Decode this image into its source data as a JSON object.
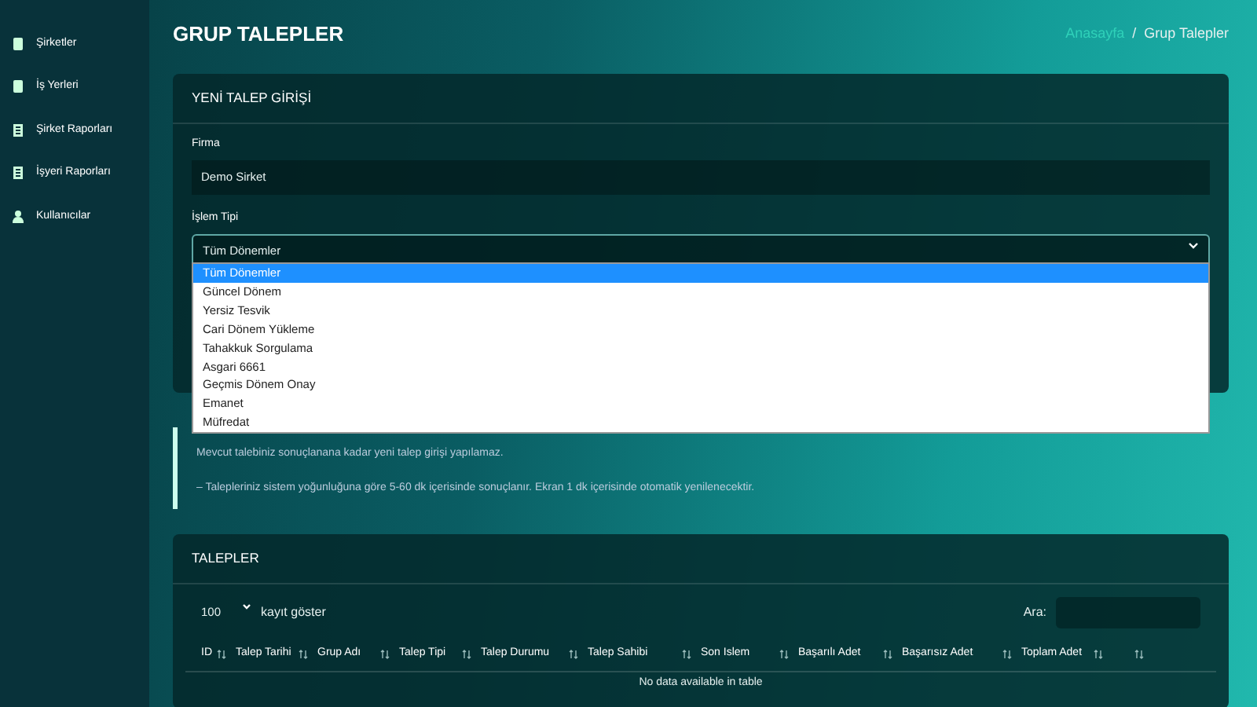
{
  "sidebar": {
    "items": [
      {
        "label": "Şirketler",
        "kind": "device"
      },
      {
        "label": "İş Yerleri",
        "kind": "device"
      },
      {
        "label": "Şirket Raporları",
        "kind": "document"
      },
      {
        "label": "İşyeri Raporları",
        "kind": "document"
      },
      {
        "label": "Kullanıcılar",
        "kind": "user"
      }
    ]
  },
  "page_title": "GRUP TALEPLER",
  "breadcrumb": [
    {
      "label": "Anasayfa",
      "kind": "link"
    },
    {
      "label": "/",
      "kind": "sep"
    },
    {
      "label": "Grup Talepler",
      "kind": "current"
    }
  ],
  "form_card": {
    "title": "YENİ TALEP GİRİŞİ",
    "firma_label": "Firma",
    "firma_value": "Demo Sirket",
    "islem_label": "İşlem Tipi",
    "islem_value": "Tüm Dönemler",
    "options": [
      {
        "label": "Tüm Dönemler",
        "selected": true
      },
      {
        "label": "Güncel Dönem",
        "selected": false
      },
      {
        "label": "Yersiz Tesvik",
        "selected": false
      },
      {
        "label": "Cari Dönem Yükleme",
        "selected": false
      },
      {
        "label": "Tahakkuk Sorgulama",
        "selected": false
      },
      {
        "label": "Asgari 6661",
        "selected": false
      },
      {
        "label": "Geçmis Dönem Onay",
        "selected": false
      },
      {
        "label": "Emanet",
        "selected": false
      },
      {
        "label": "Müfredat",
        "selected": false
      }
    ]
  },
  "notice": [
    "Mevcut talebiniz sonuçlanana kadar yeni talep girişi yapılamaz.",
    "– Talepleriniz sistem yoğunluğuna göre 5-60 dk içerisinde sonuçlanır. Ekran 1 dk içerisinde otomatik yenilenecektir."
  ],
  "table_card": {
    "title": "TALEPLER",
    "length_value": "100",
    "length_label": "kayıt göster",
    "search_label": "Ara:",
    "columns": [
      "ID",
      "Talep Tarihi",
      "Grup Adı",
      "Talep Tipi",
      "Talep Durumu",
      "Talep Sahibi",
      "Son Islem",
      "Başarılı Adet",
      "Başarısız Adet",
      "Toplam Adet",
      ""
    ],
    "empty": "No data available in table"
  }
}
